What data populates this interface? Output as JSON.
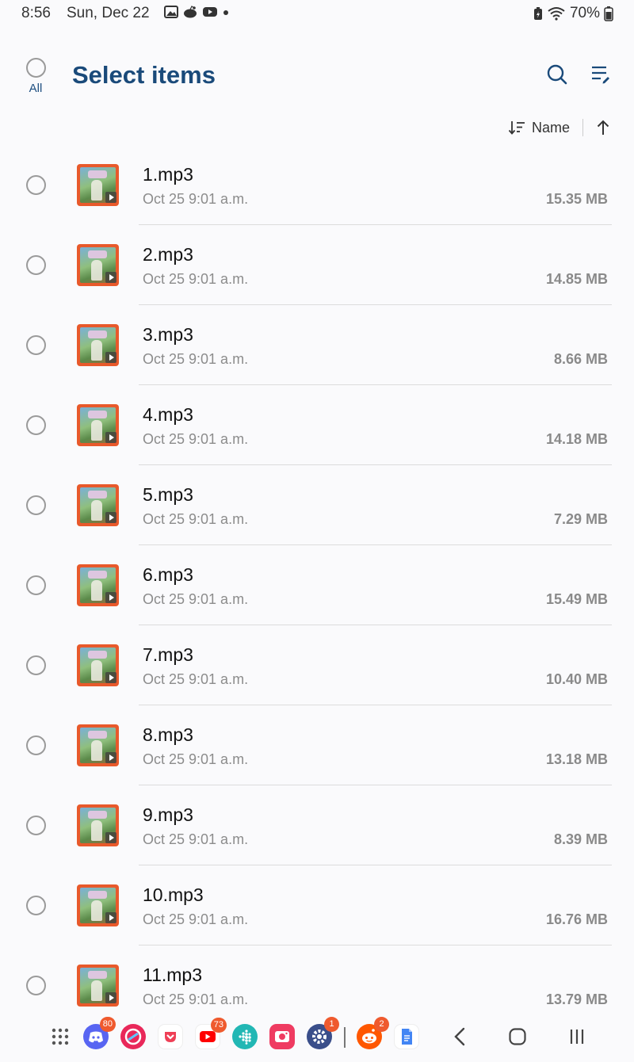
{
  "status_bar": {
    "time": "8:56",
    "date": "Sun, Dec 22",
    "notification_icons": [
      "image-icon",
      "reddit-icon",
      "youtube-icon",
      "dot-icon"
    ],
    "battery_percent": "70%"
  },
  "header": {
    "select_all_label": "All",
    "title": "Select items",
    "search_icon": "search-icon",
    "edit_list_icon": "edit-list-icon"
  },
  "sort": {
    "label": "Name",
    "direction": "ascending"
  },
  "files": [
    {
      "name": "1.mp3",
      "date": "Oct 25 9:01 a.m.",
      "size": "15.35 MB"
    },
    {
      "name": "2.mp3",
      "date": "Oct 25 9:01 a.m.",
      "size": "14.85 MB"
    },
    {
      "name": "3.mp3",
      "date": "Oct 25 9:01 a.m.",
      "size": "8.66 MB"
    },
    {
      "name": "4.mp3",
      "date": "Oct 25 9:01 a.m.",
      "size": "14.18 MB"
    },
    {
      "name": "5.mp3",
      "date": "Oct 25 9:01 a.m.",
      "size": "7.29 MB"
    },
    {
      "name": "6.mp3",
      "date": "Oct 25 9:01 a.m.",
      "size": "15.49 MB"
    },
    {
      "name": "7.mp3",
      "date": "Oct 25 9:01 a.m.",
      "size": "10.40 MB"
    },
    {
      "name": "8.mp3",
      "date": "Oct 25 9:01 a.m.",
      "size": "13.18 MB"
    },
    {
      "name": "9.mp3",
      "date": "Oct 25 9:01 a.m.",
      "size": "8.39 MB"
    },
    {
      "name": "10.mp3",
      "date": "Oct 25 9:01 a.m.",
      "size": "16.76 MB"
    },
    {
      "name": "11.mp3",
      "date": "Oct 25 9:01 a.m.",
      "size": "13.79 MB"
    }
  ],
  "taskbar": {
    "discord_badge": "80",
    "youtube_badge": "73",
    "settings_badge": "1",
    "reddit_badge": "2"
  },
  "colors": {
    "accent": "#1a4a7a",
    "badge": "#ef5a2e",
    "thumbnail_border": "#e8592b"
  }
}
